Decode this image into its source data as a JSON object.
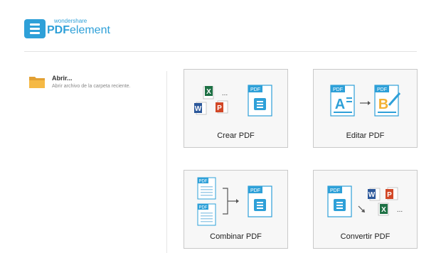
{
  "header": {
    "brand_small": "wondershare",
    "brand_bold": "PDF",
    "brand_rest": "element",
    "logo_icon": "menu-icon"
  },
  "open": {
    "icon": "folder-icon",
    "title": "Abrir...",
    "subtitle": "Abrir archivo de la carpeta reciente."
  },
  "tiles": [
    {
      "label": "Crear PDF"
    },
    {
      "label": "Editar PDF"
    },
    {
      "label": "Combinar PDF"
    },
    {
      "label": "Convertir PDF"
    }
  ],
  "icons": {
    "pdf_badge": "PDF",
    "excel_letter": "X",
    "word_letter": "W",
    "ppt_letter": "P",
    "ellipsis": "...",
    "edit_letter_a": "A",
    "edit_letter_b": "B"
  },
  "colors": {
    "brand": "#2ea0d8",
    "excel": "#1e7145",
    "word": "#2b579a",
    "powerpoint": "#d24726",
    "folder": "#f5b945"
  }
}
